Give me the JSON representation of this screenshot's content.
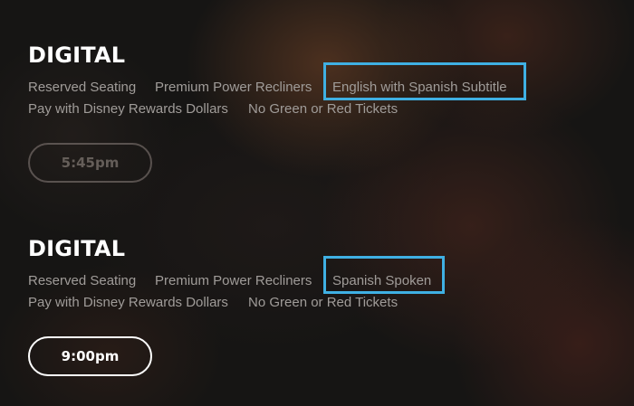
{
  "showings": [
    {
      "format_title": "DIGITAL",
      "amenities_row1": [
        "Reserved Seating",
        "Premium Power Recliners",
        "English with Spanish Subtitle"
      ],
      "amenities_row2": [
        "Pay with Disney Rewards Dollars",
        "No Green or Red Tickets"
      ],
      "highlighted_amenity": "English with Spanish Subtitle",
      "showtime": "5:45pm",
      "showtime_available": false
    },
    {
      "format_title": "DIGITAL",
      "amenities_row1": [
        "Reserved Seating",
        "Premium Power Recliners",
        "Spanish Spoken"
      ],
      "amenities_row2": [
        "Pay with Disney Rewards Dollars",
        "No Green or Red Tickets"
      ],
      "highlighted_amenity": "Spanish Spoken",
      "showtime": "9:00pm",
      "showtime_available": true
    }
  ],
  "colors": {
    "highlight_box": "#3fb0e3",
    "title_text": "#ffffff",
    "amenity_text": "#a09c99",
    "background": "#161514"
  }
}
